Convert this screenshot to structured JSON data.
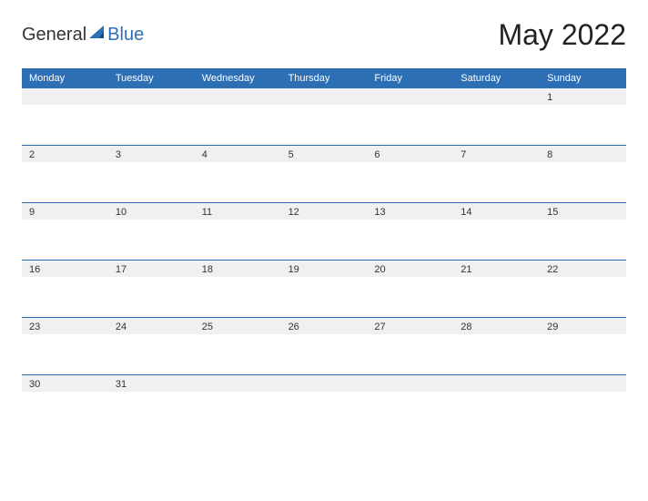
{
  "brand": {
    "text1": "General",
    "text2": "Blue"
  },
  "title": "May 2022",
  "dayHeaders": [
    "Monday",
    "Tuesday",
    "Wednesday",
    "Thursday",
    "Friday",
    "Saturday",
    "Sunday"
  ],
  "weeks": [
    [
      "",
      "",
      "",
      "",
      "",
      "",
      "1"
    ],
    [
      "2",
      "3",
      "4",
      "5",
      "6",
      "7",
      "8"
    ],
    [
      "9",
      "10",
      "11",
      "12",
      "13",
      "14",
      "15"
    ],
    [
      "16",
      "17",
      "18",
      "19",
      "20",
      "21",
      "22"
    ],
    [
      "23",
      "24",
      "25",
      "26",
      "27",
      "28",
      "29"
    ],
    [
      "30",
      "31",
      "",
      "",
      "",
      "",
      ""
    ]
  ]
}
